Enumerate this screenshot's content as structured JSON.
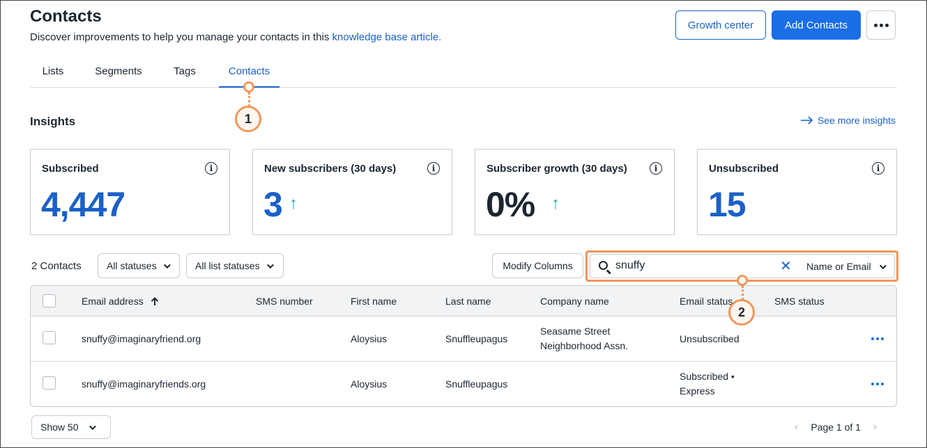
{
  "header": {
    "title": "Contacts",
    "description": "Discover improvements to help you manage your contacts in this ",
    "description_link": "knowledge base article.",
    "growth_center_label": "Growth center",
    "add_contacts_label": "Add Contacts"
  },
  "tabs": [
    {
      "label": "Lists"
    },
    {
      "label": "Segments"
    },
    {
      "label": "Tags"
    },
    {
      "label": "Contacts",
      "active": true
    }
  ],
  "callouts": [
    "1",
    "2"
  ],
  "insights": {
    "title": "Insights",
    "see_more": "See more insights",
    "cards": [
      {
        "label": "Subscribed",
        "value": "4,447"
      },
      {
        "label": "New subscribers (30 days)",
        "value": "3"
      },
      {
        "label": "Subscriber growth (30 days)",
        "value": "0%"
      },
      {
        "label": "Unsubscribed",
        "value": "15"
      }
    ]
  },
  "toolbar": {
    "count": "2 Contacts",
    "status_filter": "All statuses",
    "list_status_filter": "All list statuses",
    "modify_columns": "Modify Columns",
    "search_value": "snuffy",
    "search_mode": "Name or Email"
  },
  "table": {
    "columns": [
      "Email address",
      "SMS number",
      "First name",
      "Last name",
      "Company name",
      "Email status",
      "SMS status"
    ],
    "rows": [
      {
        "email": "snuffy@imaginaryfriend.org",
        "sms": "",
        "first": "Aloysius",
        "last": "Snuffleupagus",
        "company_line1": "Seasame Street",
        "company_line2": "Neighborhood Assn.",
        "email_status_line1": "Unsubscribed",
        "email_status_line2": "",
        "sms_status": ""
      },
      {
        "email": "snuffy@imaginaryfriends.org",
        "sms": "",
        "first": "Aloysius",
        "last": "Snuffleupagus",
        "company_line1": "",
        "company_line2": "",
        "email_status_line1": "Subscribed •",
        "email_status_line2": "Express",
        "sms_status": ""
      }
    ]
  },
  "pagination": {
    "show": "Show 50",
    "page": "Page 1 of 1"
  },
  "colors": {
    "accent": "#1a61c7",
    "primary_button": "#1a6ee6",
    "callout": "#f0965a",
    "trend_arrow": "#1aa6a6"
  },
  "icons": [
    "ellipsis-icon",
    "info-icon",
    "arrow-up-icon",
    "arrow-right-icon",
    "search-icon",
    "clear-icon",
    "chevron-down-icon",
    "sort-ascending-icon",
    "chevron-left-icon",
    "chevron-right-icon"
  ]
}
